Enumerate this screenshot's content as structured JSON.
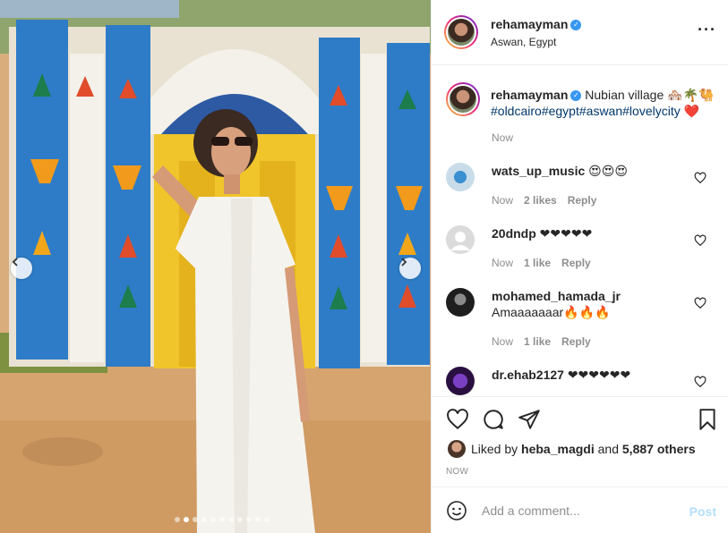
{
  "post": {
    "username": "rehamayman",
    "location": "Aswan, Egypt",
    "verified_icon": "verified-badge-icon",
    "more_icon": "more-options-icon"
  },
  "caption": {
    "username": "rehamayman",
    "text": "Nubian village 🏘️🌴🐫",
    "hashtags": [
      "#oldcairo",
      "#egypt",
      "#aswan",
      "#lovelycity"
    ],
    "trail_emoji": "❤️",
    "time": "Now"
  },
  "comments": [
    {
      "username": "wats_up_music",
      "text": "😍😍😍",
      "time": "Now",
      "likes": "2 likes",
      "reply": "Reply"
    },
    {
      "username": "20dndp",
      "text": "❤❤❤❤❤",
      "time": "Now",
      "likes": "1 like",
      "reply": "Reply"
    },
    {
      "username": "mohamed_hamada_jr",
      "text": "Amaaaaaaar🔥🔥🔥",
      "time": "Now",
      "likes": "1 like",
      "reply": "Reply"
    },
    {
      "username": "dr.ehab2127",
      "text": "❤❤❤❤❤❤",
      "time": "",
      "likes": "",
      "reply": ""
    }
  ],
  "actions": {
    "liked_by_prefix": "Liked by",
    "liked_by_user": "heba_magdi",
    "and": "and",
    "others": "5,887 others",
    "posted_time": "NOW"
  },
  "add_comment": {
    "placeholder": "Add a comment...",
    "post_label": "Post"
  },
  "carousel": {
    "slide_count": 11,
    "active_index": 1
  },
  "colors": {
    "link_tag": "#00376b",
    "verified": "#3897f0",
    "post_disabled": "#b2dffc",
    "muted": "#8e8e8e"
  }
}
